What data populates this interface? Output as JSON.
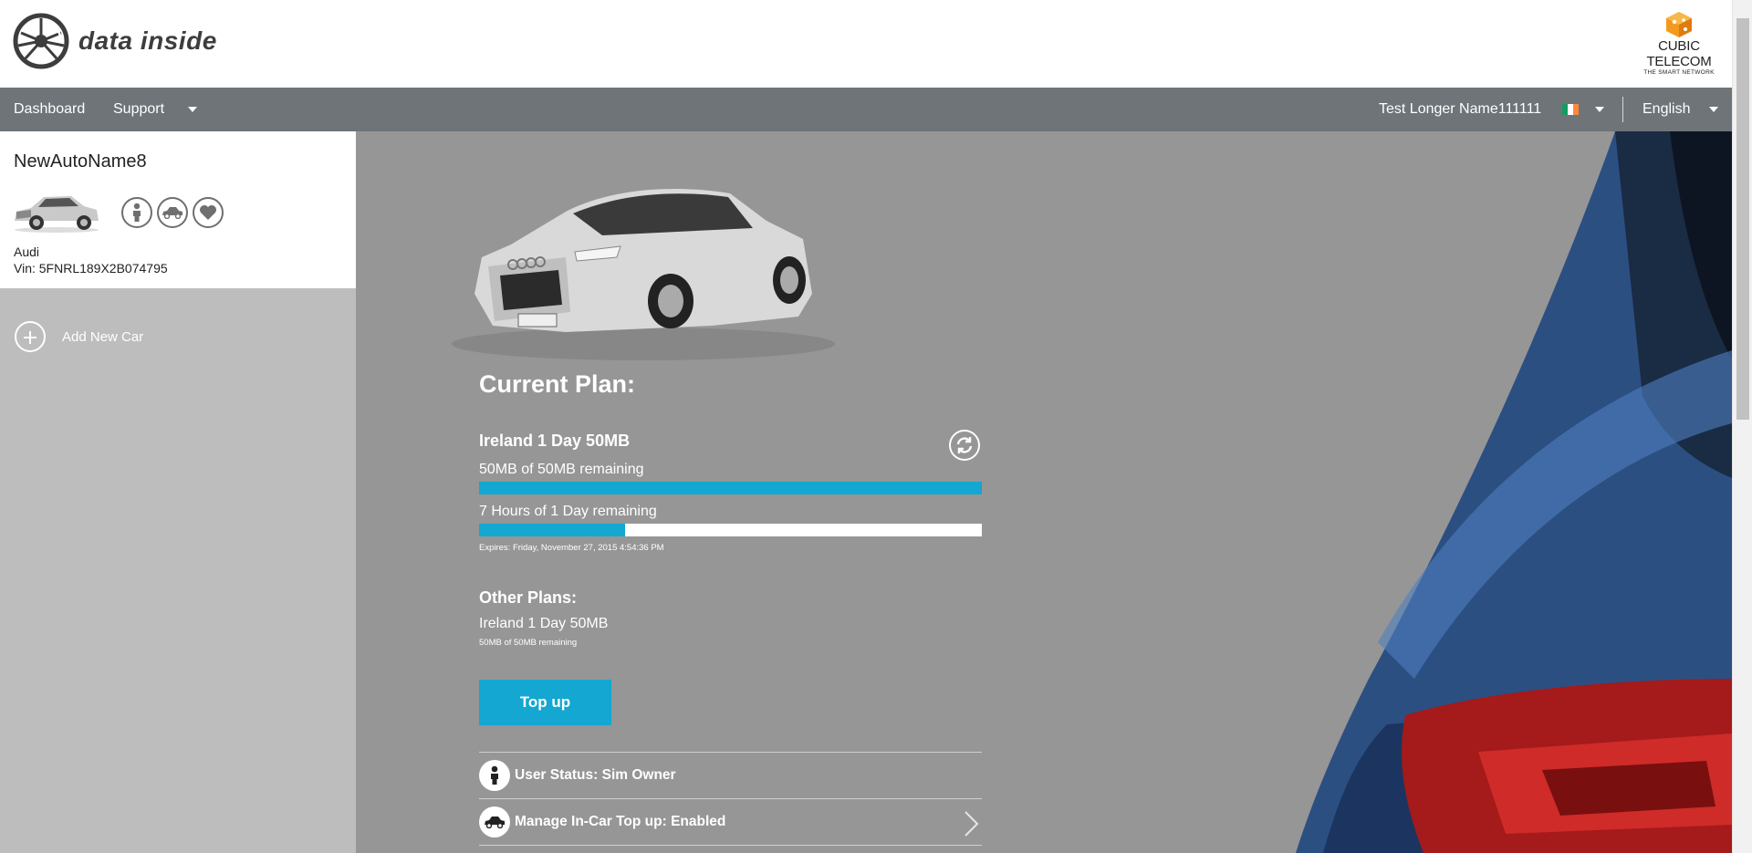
{
  "brand": {
    "name": "data inside",
    "partner_name": "CUBIC TELECOM",
    "partner_tagline": "THE SMART NETWORK"
  },
  "nav": {
    "dashboard": "Dashboard",
    "support": "Support",
    "user_name": "Test Longer Name111111",
    "language": "English",
    "flag_colors": [
      "#169b62",
      "#ffffff",
      "#ff883e"
    ]
  },
  "sidebar": {
    "car": {
      "name": "NewAutoName8",
      "make": "Audi",
      "vin": "Vin: 5FNRL189X2B074795",
      "status_icons": [
        "person-icon",
        "car-icon",
        "heart-icon"
      ]
    },
    "add_car_label": "Add New Car"
  },
  "plan": {
    "heading": "Current Plan:",
    "name": "Ireland 1 Day 50MB",
    "data_remaining": "50MB of 50MB remaining",
    "data_fraction": 1.0,
    "time_remaining": "7 Hours of 1 Day remaining",
    "time_fraction": 0.29,
    "expires": "Expires: Friday, November 27, 2015 4:54:36 PM"
  },
  "other_plans": {
    "heading": "Other Plans:",
    "items": [
      {
        "name": "Ireland 1 Day 50MB",
        "remaining": "50MB of 50MB remaining"
      }
    ]
  },
  "topup_label": "Top up",
  "rows": [
    {
      "icon": "person-icon",
      "label": "User Status: Sim Owner"
    },
    {
      "icon": "car-icon",
      "label": "Manage In-Car Top up: Enabled"
    }
  ],
  "colors": {
    "accent": "#13a7d1",
    "navbar": "#6e7478",
    "sidebar": "#bdbdbd",
    "main": "#969696"
  }
}
